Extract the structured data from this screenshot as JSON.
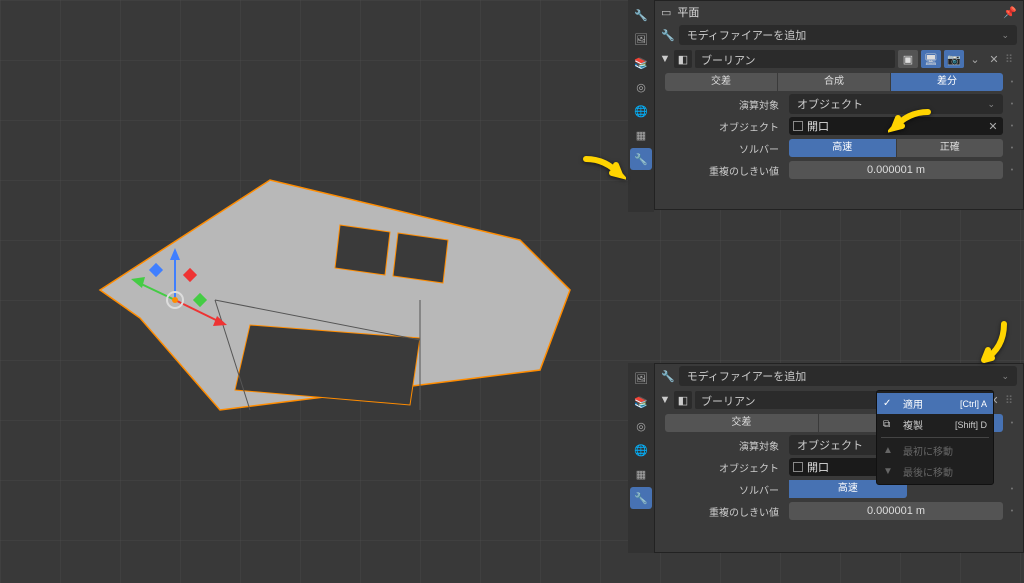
{
  "object_name": "平面",
  "modifier_add_label": "モディファイアーを追加",
  "modifier": {
    "name": "ブーリアン",
    "ops": {
      "intersect": "交差",
      "union": "合成",
      "difference": "差分"
    },
    "operand_label": "演算対象",
    "operand_value": "オブジェクト",
    "object_label": "オブジェクト",
    "object_value": "開口",
    "solver_label": "ソルバー",
    "solver_fast": "高速",
    "solver_exact": "正確",
    "threshold_label": "重複のしきい値",
    "threshold_value": "0.000001 m"
  },
  "menu": {
    "apply": "適用",
    "apply_shortcut": "[Ctrl] A",
    "duplicate": "複製",
    "duplicate_shortcut": "[Shift] D",
    "move_first": "最初に移動",
    "move_last": "最後に移動"
  }
}
